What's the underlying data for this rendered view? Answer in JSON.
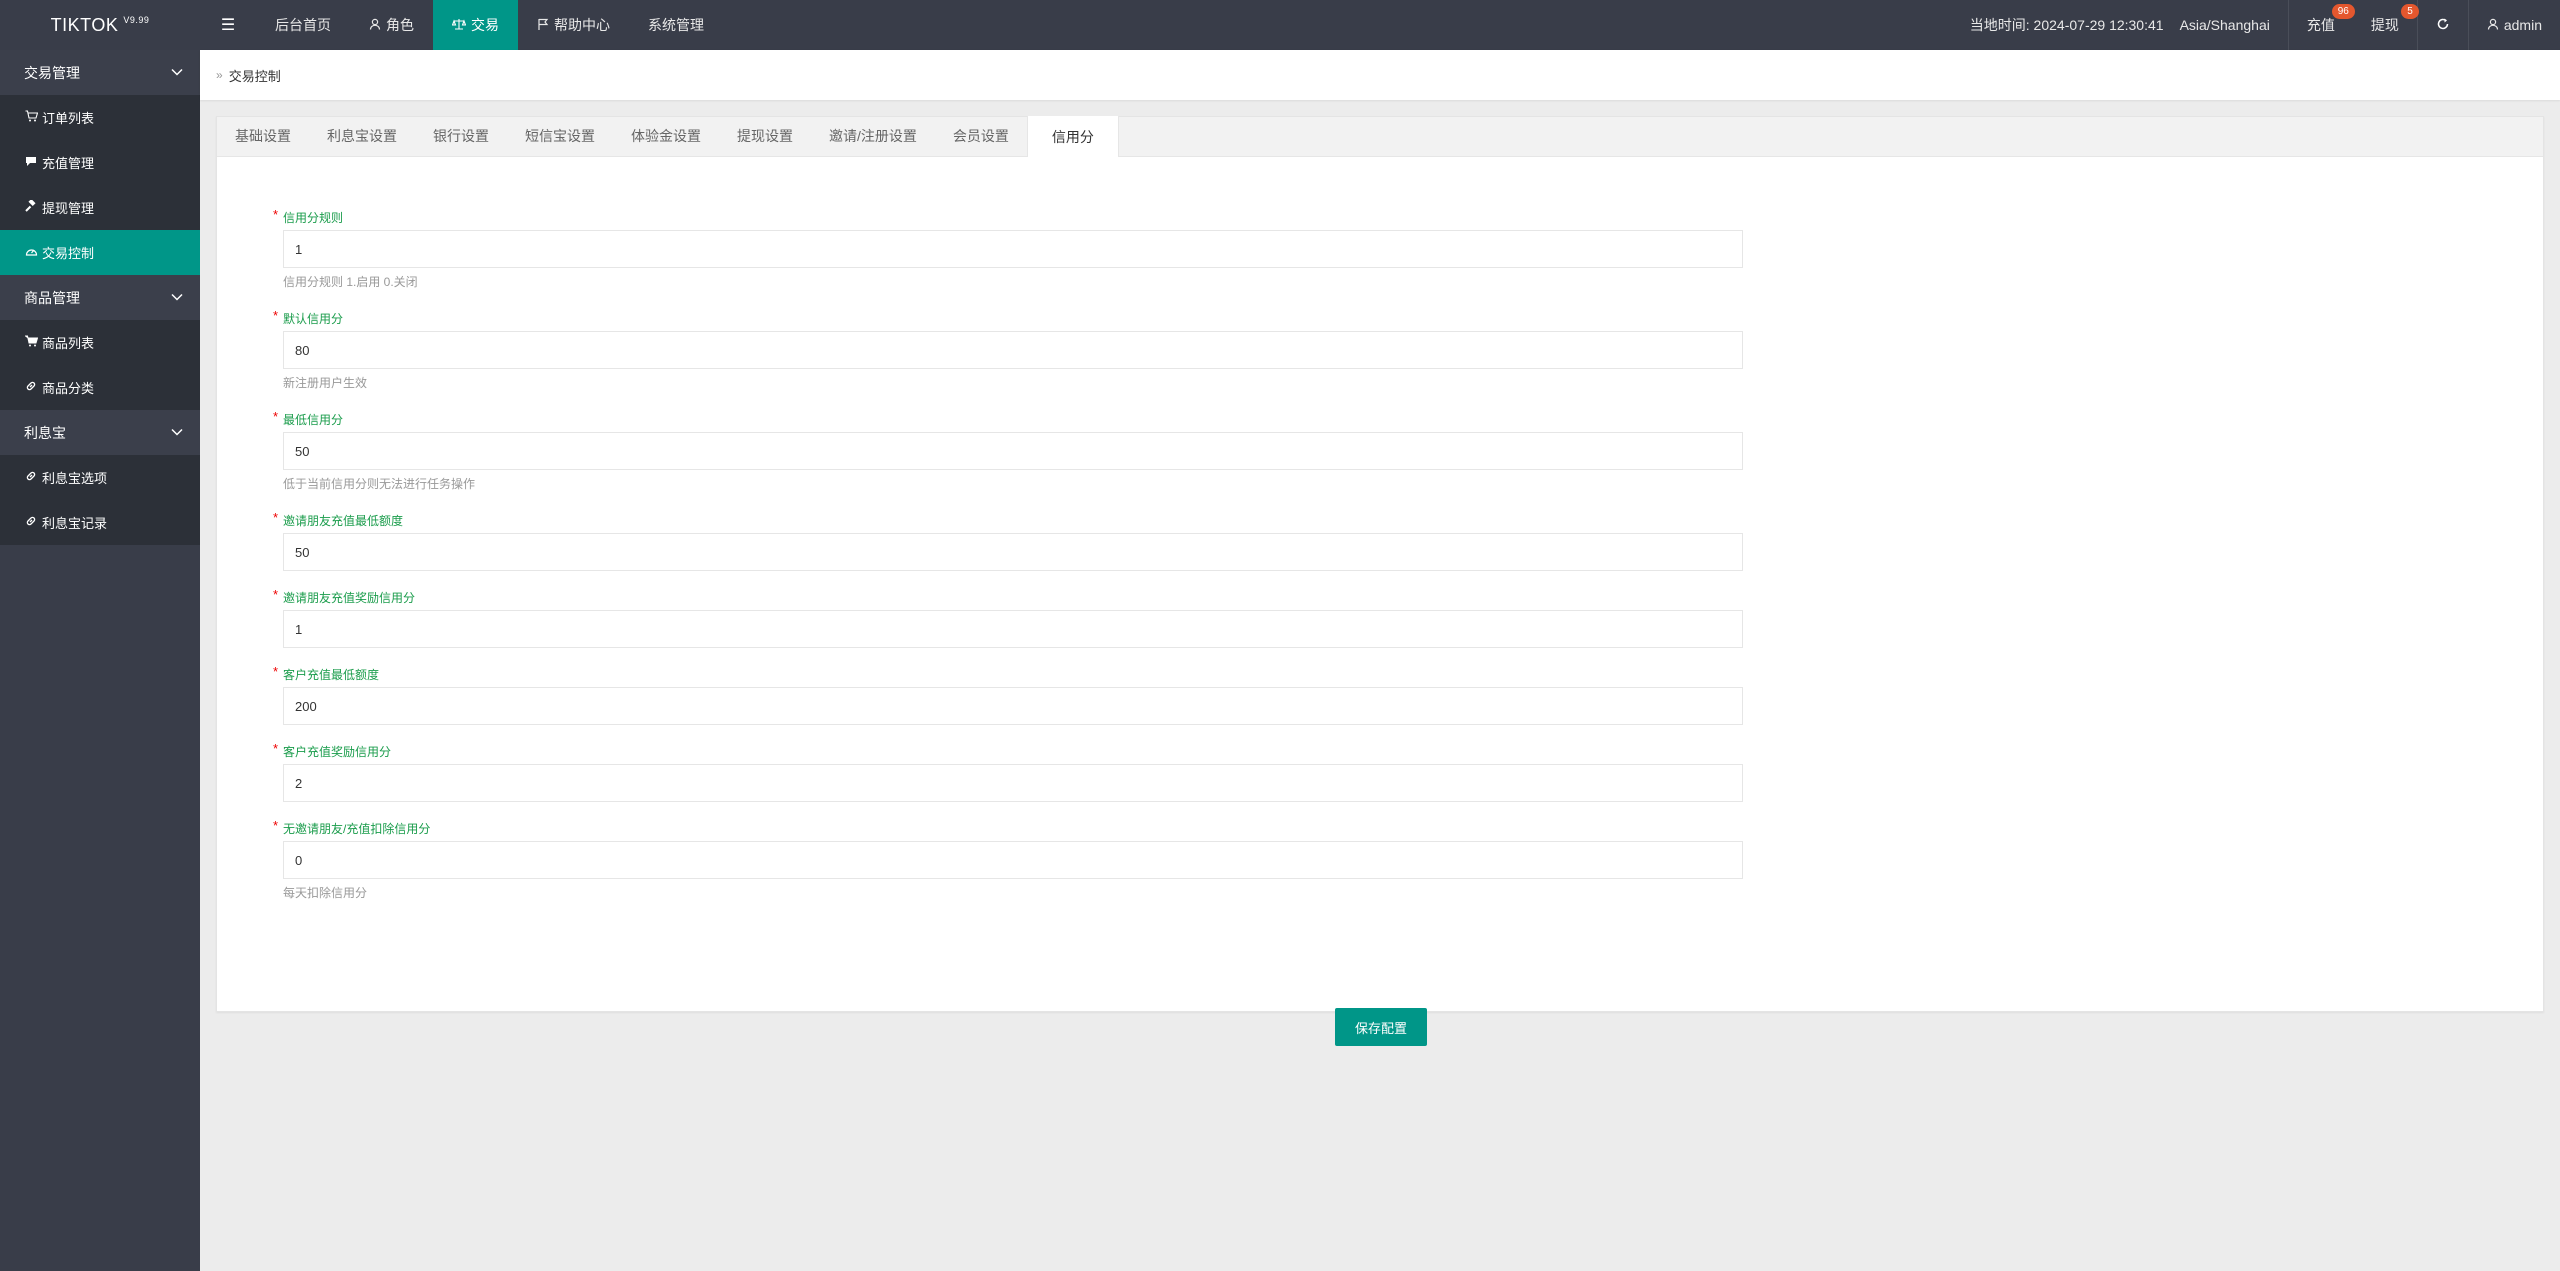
{
  "header": {
    "logo": "TIKTOK",
    "version": "V9.99",
    "nav": [
      {
        "label": "后台首页",
        "icon": "",
        "active": false
      },
      {
        "label": "角色",
        "icon": "user-icon",
        "active": false
      },
      {
        "label": "交易",
        "icon": "scale-icon",
        "active": true
      },
      {
        "label": "帮助中心",
        "icon": "flag-icon",
        "active": false
      },
      {
        "label": "系统管理",
        "icon": "",
        "active": false
      }
    ],
    "time_label": "当地时间: 2024-07-29 12:30:41",
    "timezone": "Asia/Shanghai",
    "recharge_label": "充值",
    "recharge_count": "96",
    "withdraw_label": "提现",
    "withdraw_count": "5",
    "user_name": "admin"
  },
  "sidebar": {
    "groups": [
      {
        "label": "交易管理",
        "items": [
          {
            "label": "订单列表",
            "icon": "cart-icon",
            "active": false
          },
          {
            "label": "充值管理",
            "icon": "comment-icon",
            "active": false
          },
          {
            "label": "提现管理",
            "icon": "gavel-icon",
            "active": false
          },
          {
            "label": "交易控制",
            "icon": "dashboard-icon",
            "active": true
          }
        ]
      },
      {
        "label": "商品管理",
        "items": [
          {
            "label": "商品列表",
            "icon": "cart-icon",
            "active": false
          },
          {
            "label": "商品分类",
            "icon": "link-icon",
            "active": false
          }
        ]
      },
      {
        "label": "利息宝",
        "items": [
          {
            "label": "利息宝选项",
            "icon": "link-icon",
            "active": false
          },
          {
            "label": "利息宝记录",
            "icon": "link-icon",
            "active": false
          }
        ]
      }
    ]
  },
  "breadcrumb": "交易控制",
  "tabs": [
    "基础设置",
    "利息宝设置",
    "银行设置",
    "短信宝设置",
    "体验金设置",
    "提现设置",
    "邀请/注册设置",
    "会员设置",
    "信用分"
  ],
  "active_tab": "信用分",
  "form": {
    "fields": [
      {
        "label": "信用分规则",
        "value": "1",
        "help": "信用分规则 1.启用 0.关闭"
      },
      {
        "label": "默认信用分",
        "value": "80",
        "help": "新注册用户生效"
      },
      {
        "label": "最低信用分",
        "value": "50",
        "help": "低于当前信用分则无法进行任务操作"
      },
      {
        "label": "邀请朋友充值最低额度",
        "value": "50",
        "help": ""
      },
      {
        "label": "邀请朋友充值奖励信用分",
        "value": "1",
        "help": ""
      },
      {
        "label": "客户充值最低额度",
        "value": "200",
        "help": ""
      },
      {
        "label": "客户充值奖励信用分",
        "value": "2",
        "help": ""
      },
      {
        "label": "无邀请朋友/充值扣除信用分",
        "value": "0",
        "help": "每天扣除信用分"
      }
    ],
    "save_label": "保存配置"
  },
  "colors": {
    "accent": "#009688",
    "topbar": "#393d49",
    "label": "#1a9c4b",
    "badge": "#e4572e"
  }
}
